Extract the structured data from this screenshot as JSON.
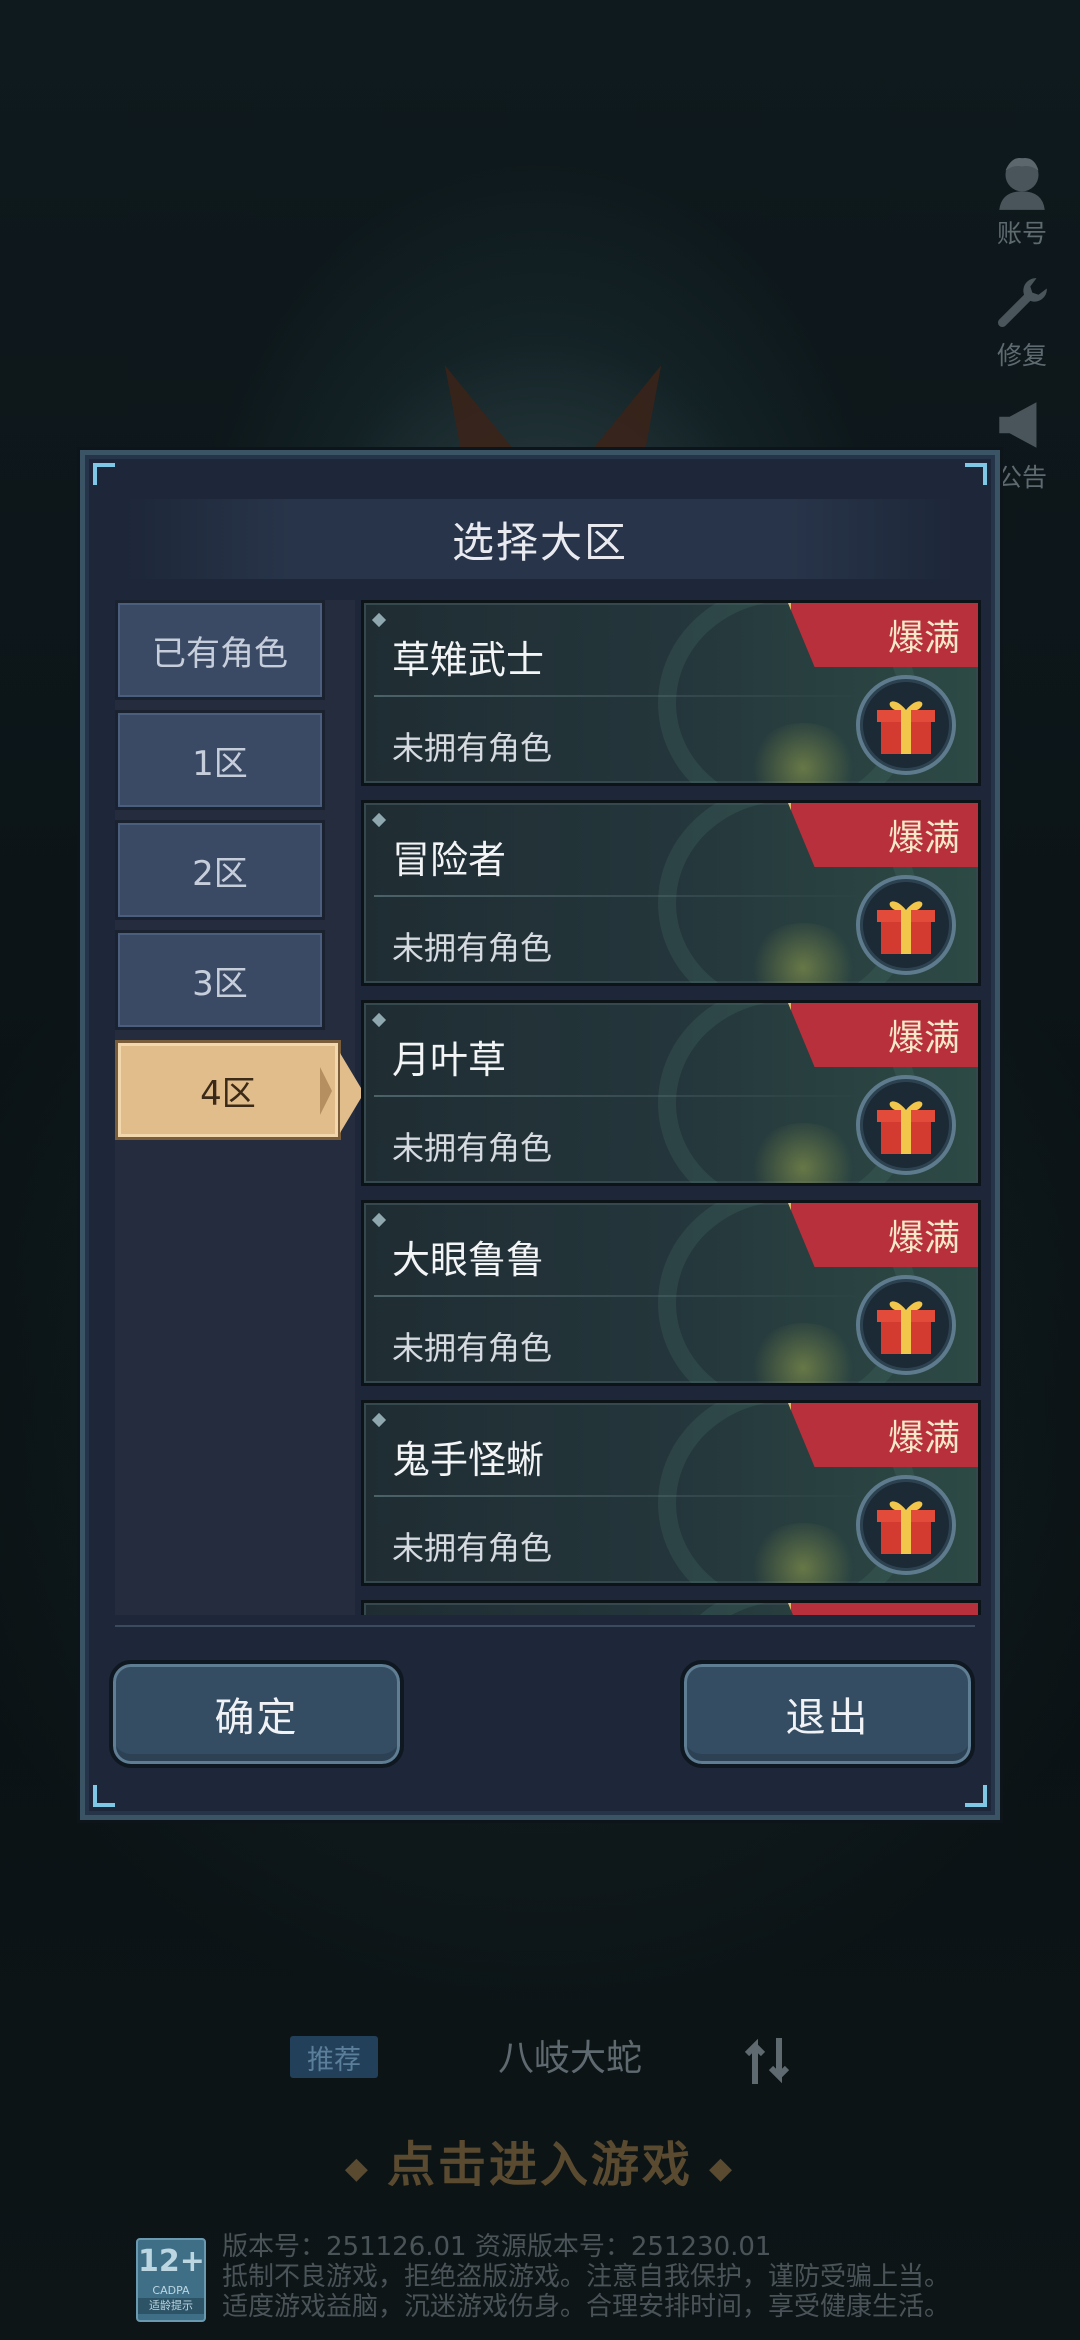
{
  "side_menu": [
    {
      "icon": "account-icon",
      "label": "账号"
    },
    {
      "icon": "wrench-icon",
      "label": "修复"
    },
    {
      "icon": "megaphone-icon",
      "label": "公告"
    }
  ],
  "dialog": {
    "title": "选择大区",
    "tabs": [
      "已有角色",
      "1区",
      "2区",
      "3区",
      "4区"
    ],
    "active_tab": "4区",
    "servers": [
      {
        "name": "草雉武士",
        "role_status": "未拥有角色",
        "status": "爆满"
      },
      {
        "name": "冒险者",
        "role_status": "未拥有角色",
        "status": "爆满"
      },
      {
        "name": "月叶草",
        "role_status": "未拥有角色",
        "status": "爆满"
      },
      {
        "name": "大眼鲁鲁",
        "role_status": "未拥有角色",
        "status": "爆满"
      },
      {
        "name": "鬼手怪蜥",
        "role_status": "未拥有角色",
        "status": "爆满"
      },
      {
        "name": "",
        "role_status": "",
        "status": ""
      }
    ],
    "confirm_label": "确定",
    "exit_label": "退出"
  },
  "login": {
    "recommend_tag": "推荐",
    "current_server": "八岐大蛇",
    "enter_label": "点击进入游戏"
  },
  "footer": {
    "age_rating": "12+",
    "rating_org": "CADPA",
    "rating_tip": "适龄提示",
    "version_line": "版本号：251126.01   资源版本号：251230.01",
    "notice_line1": "抵制不良游戏，拒绝盗版游戏。注意自我保护，谨防受骗上当。",
    "notice_line2": "适度游戏益脑，沉迷游戏伤身。合理安排时间，享受健康生活。"
  },
  "colors": {
    "status_full": "#b8303c",
    "active_tab": "#e2bd8c",
    "button": "#344d63"
  }
}
